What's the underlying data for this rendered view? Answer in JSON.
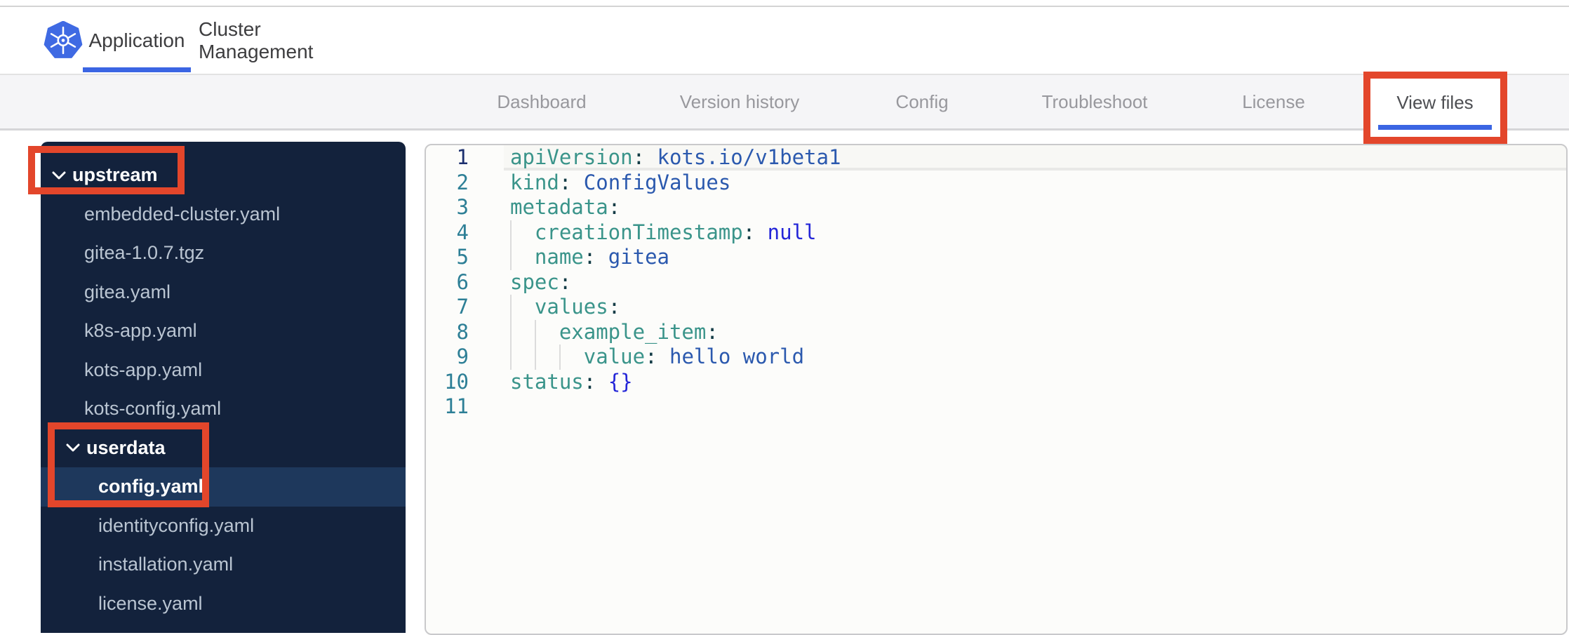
{
  "header": {
    "logo_name": "kubernetes-logo",
    "logo_color": "#3f6ae3",
    "tabs": [
      {
        "label": "Application",
        "active": true
      },
      {
        "label": "Cluster Management",
        "active": false
      }
    ]
  },
  "app_nav": {
    "items": [
      {
        "label": "Dashboard",
        "active": false
      },
      {
        "label": "Version history",
        "active": false
      },
      {
        "label": "Config",
        "active": false
      },
      {
        "label": "Troubleshoot",
        "active": false
      },
      {
        "label": "License",
        "active": false
      },
      {
        "label": "View files",
        "active": true
      }
    ],
    "active_underline_color": "#3b65e3"
  },
  "file_tree": {
    "background_color": "#13223c",
    "selected_row_color": "#1e385c",
    "items": [
      {
        "kind": "folder",
        "label": "upstream",
        "depth": 0,
        "expanded": true
      },
      {
        "kind": "file",
        "label": "embedded-cluster.yaml",
        "depth": 1
      },
      {
        "kind": "file",
        "label": "gitea-1.0.7.tgz",
        "depth": 1
      },
      {
        "kind": "file",
        "label": "gitea.yaml",
        "depth": 1
      },
      {
        "kind": "file",
        "label": "k8s-app.yaml",
        "depth": 1
      },
      {
        "kind": "file",
        "label": "kots-app.yaml",
        "depth": 1
      },
      {
        "kind": "file",
        "label": "kots-config.yaml",
        "depth": 1
      },
      {
        "kind": "folder",
        "label": "userdata",
        "depth": 1,
        "expanded": true
      },
      {
        "kind": "file",
        "label": "config.yaml",
        "depth": 2,
        "selected": true
      },
      {
        "kind": "file",
        "label": "identityconfig.yaml",
        "depth": 2
      },
      {
        "kind": "file",
        "label": "installation.yaml",
        "depth": 2
      },
      {
        "kind": "file",
        "label": "license.yaml",
        "depth": 2
      }
    ]
  },
  "editor": {
    "syntax_colors": {
      "key": "#3a948a",
      "colon": "#143c46",
      "value": "#2b59ae",
      "keyword": "#2426d8"
    },
    "lines": [
      {
        "n": "1",
        "active": true,
        "guides": 0,
        "tokens": [
          [
            "k",
            "apiVersion"
          ],
          [
            "p",
            ":"
          ],
          [
            "v",
            " kots.io/v1beta1"
          ]
        ]
      },
      {
        "n": "2",
        "guides": 0,
        "tokens": [
          [
            "k",
            "kind"
          ],
          [
            "p",
            ":"
          ],
          [
            "v",
            " ConfigValues"
          ]
        ]
      },
      {
        "n": "3",
        "guides": 0,
        "tokens": [
          [
            "k",
            "metadata"
          ],
          [
            "p",
            ":"
          ]
        ]
      },
      {
        "n": "4",
        "guides": 1,
        "tokens": [
          [
            "k",
            "  creationTimestamp"
          ],
          [
            "p",
            ":"
          ],
          [
            "b",
            " null"
          ]
        ]
      },
      {
        "n": "5",
        "guides": 1,
        "tokens": [
          [
            "k",
            "  name"
          ],
          [
            "p",
            ":"
          ],
          [
            "v",
            " gitea"
          ]
        ]
      },
      {
        "n": "6",
        "guides": 0,
        "tokens": [
          [
            "k",
            "spec"
          ],
          [
            "p",
            ":"
          ]
        ]
      },
      {
        "n": "7",
        "guides": 1,
        "tokens": [
          [
            "k",
            "  values"
          ],
          [
            "p",
            ":"
          ]
        ]
      },
      {
        "n": "8",
        "guides": 2,
        "tokens": [
          [
            "k",
            "    example_item"
          ],
          [
            "p",
            ":"
          ]
        ]
      },
      {
        "n": "9",
        "guides": 3,
        "tokens": [
          [
            "k",
            "      value"
          ],
          [
            "p",
            ":"
          ],
          [
            "v",
            " hello world"
          ]
        ]
      },
      {
        "n": "10",
        "guides": 0,
        "tokens": [
          [
            "k",
            "status"
          ],
          [
            "p",
            ":"
          ],
          [
            "b",
            " {}"
          ]
        ]
      },
      {
        "n": "11",
        "guides": 0,
        "tokens": []
      }
    ]
  },
  "annotations": {
    "color": "#e3462b",
    "targets": [
      "upstream-folder",
      "userdata-config-yaml",
      "view-files-tab"
    ]
  }
}
